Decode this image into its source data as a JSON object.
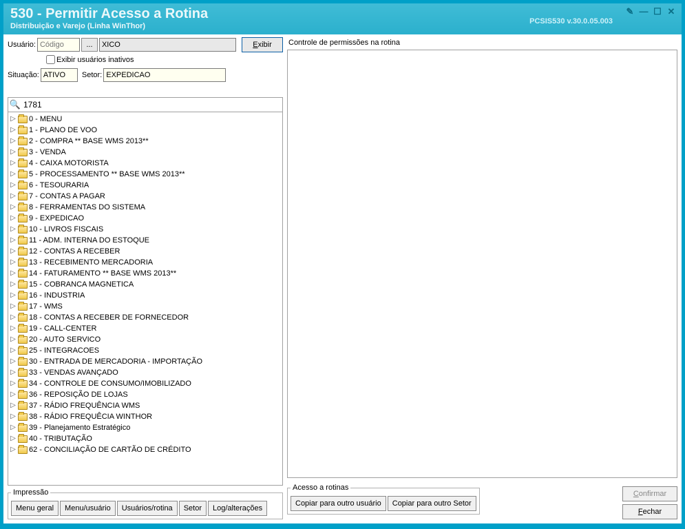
{
  "titlebar": {
    "title": "530 - Permitir Acesso a Rotina",
    "subtitle": "Distribuição e Varejo (Linha WinThor)",
    "version": "PCSIS530   v.30.0.05.003"
  },
  "filters": {
    "user_label": "Usuário:",
    "user_code_placeholder": "Código",
    "user_name": "XICO",
    "exibir_label": "Exibir",
    "inactive_label": "Exibir usuários inativos",
    "situacao_label": "Situação:",
    "situacao_value": "ATIVO",
    "setor_label": "Setor:",
    "setor_value": "EXPEDICAO"
  },
  "search": {
    "value": "1781"
  },
  "tree": [
    "0 - MENU",
    "1 - PLANO DE VOO",
    "2 - COMPRA             ** BASE WMS 2013**",
    "3 - VENDA",
    "4 - CAIXA MOTORISTA",
    "5 - PROCESSAMENTO ** BASE WMS 2013**",
    "6 - TESOURARIA",
    "7 - CONTAS A PAGAR",
    "8 - FERRAMENTAS DO SISTEMA",
    "9 - EXPEDICAO",
    "10 - LIVROS FISCAIS",
    "11 - ADM. INTERNA DO ESTOQUE",
    "12 - CONTAS A RECEBER",
    "13 - RECEBIMENTO MERCADORIA",
    "14 - FATURAMENTO  ** BASE WMS 2013**",
    "15 - COBRANCA MAGNETICA",
    "16 - INDUSTRIA",
    "17 - WMS",
    "18 - CONTAS A RECEBER DE FORNECEDOR",
    "19 - CALL-CENTER",
    "20 - AUTO SERVICO",
    "25 - INTEGRACOES",
    "30 - ENTRADA DE MERCADORIA - IMPORTAÇÃO",
    "33 - VENDAS AVANÇADO",
    "34 - CONTROLE DE CONSUMO/IMOBILIZADO",
    "36 - REPOSIÇÃO DE LOJAS",
    "37 - RÁDIO FREQUÊNCIA WMS",
    "38 - RÁDIO FREQUÊCIA WINTHOR",
    "39 - Planejamento Estratégico",
    "40 - TRIBUTAÇÃO",
    "62 - CONCILIAÇÃO DE CARTÃO DE CRÉDITO"
  ],
  "impressao": {
    "legend": "Impressão",
    "buttons": [
      "Menu geral",
      "Menu/usuário",
      "Usuários/rotina",
      "Setor",
      "Log/alterações"
    ]
  },
  "right": {
    "perm_label": "Controle de permissões na rotina"
  },
  "acesso": {
    "legend": "Acesso a rotinas",
    "buttons": [
      "Copiar para outro usuário",
      "Copiar para outro Setor"
    ]
  },
  "actions": {
    "confirm": "Confirmar",
    "close": "Fechar"
  }
}
